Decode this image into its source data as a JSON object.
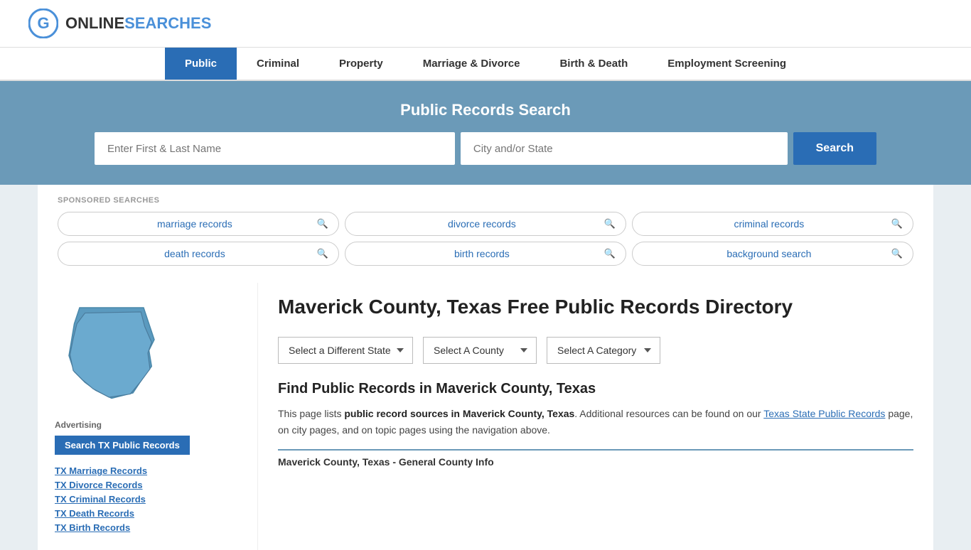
{
  "logo": {
    "text_online": "ONLINE",
    "text_searches": "SEARCHES",
    "icon_letter": "G"
  },
  "nav": {
    "items": [
      {
        "label": "Public",
        "active": true
      },
      {
        "label": "Criminal",
        "active": false
      },
      {
        "label": "Property",
        "active": false
      },
      {
        "label": "Marriage & Divorce",
        "active": false
      },
      {
        "label": "Birth & Death",
        "active": false
      },
      {
        "label": "Employment Screening",
        "active": false
      }
    ]
  },
  "hero": {
    "title": "Public Records Search",
    "name_placeholder": "Enter First & Last Name",
    "city_placeholder": "City and/or State",
    "search_button": "Search"
  },
  "sponsored": {
    "label": "SPONSORED SEARCHES",
    "items": [
      {
        "text": "marriage records"
      },
      {
        "text": "divorce records"
      },
      {
        "text": "criminal records"
      },
      {
        "text": "death records"
      },
      {
        "text": "birth records"
      },
      {
        "text": "background search"
      }
    ]
  },
  "page": {
    "title": "Maverick County, Texas Free Public Records Directory",
    "dropdowns": {
      "state": "Select a Different State",
      "county": "Select A County",
      "category": "Select A Category"
    },
    "find_heading": "Find Public Records in Maverick County, Texas",
    "find_desc_1": "This page lists ",
    "find_desc_bold": "public record sources in Maverick County, Texas",
    "find_desc_2": ". Additional resources can be found on our ",
    "find_link": "Texas State Public Records",
    "find_desc_3": " page, on city pages, and on topic pages using the navigation above.",
    "county_info_label": "Maverick County, Texas - General County Info"
  },
  "sidebar": {
    "advertising_label": "Advertising",
    "ad_button": "Search TX Public Records",
    "links": [
      {
        "label": "TX Marriage Records"
      },
      {
        "label": "TX Divorce Records"
      },
      {
        "label": "TX Criminal Records"
      },
      {
        "label": "TX Death Records"
      },
      {
        "label": "TX Birth Records"
      }
    ]
  }
}
